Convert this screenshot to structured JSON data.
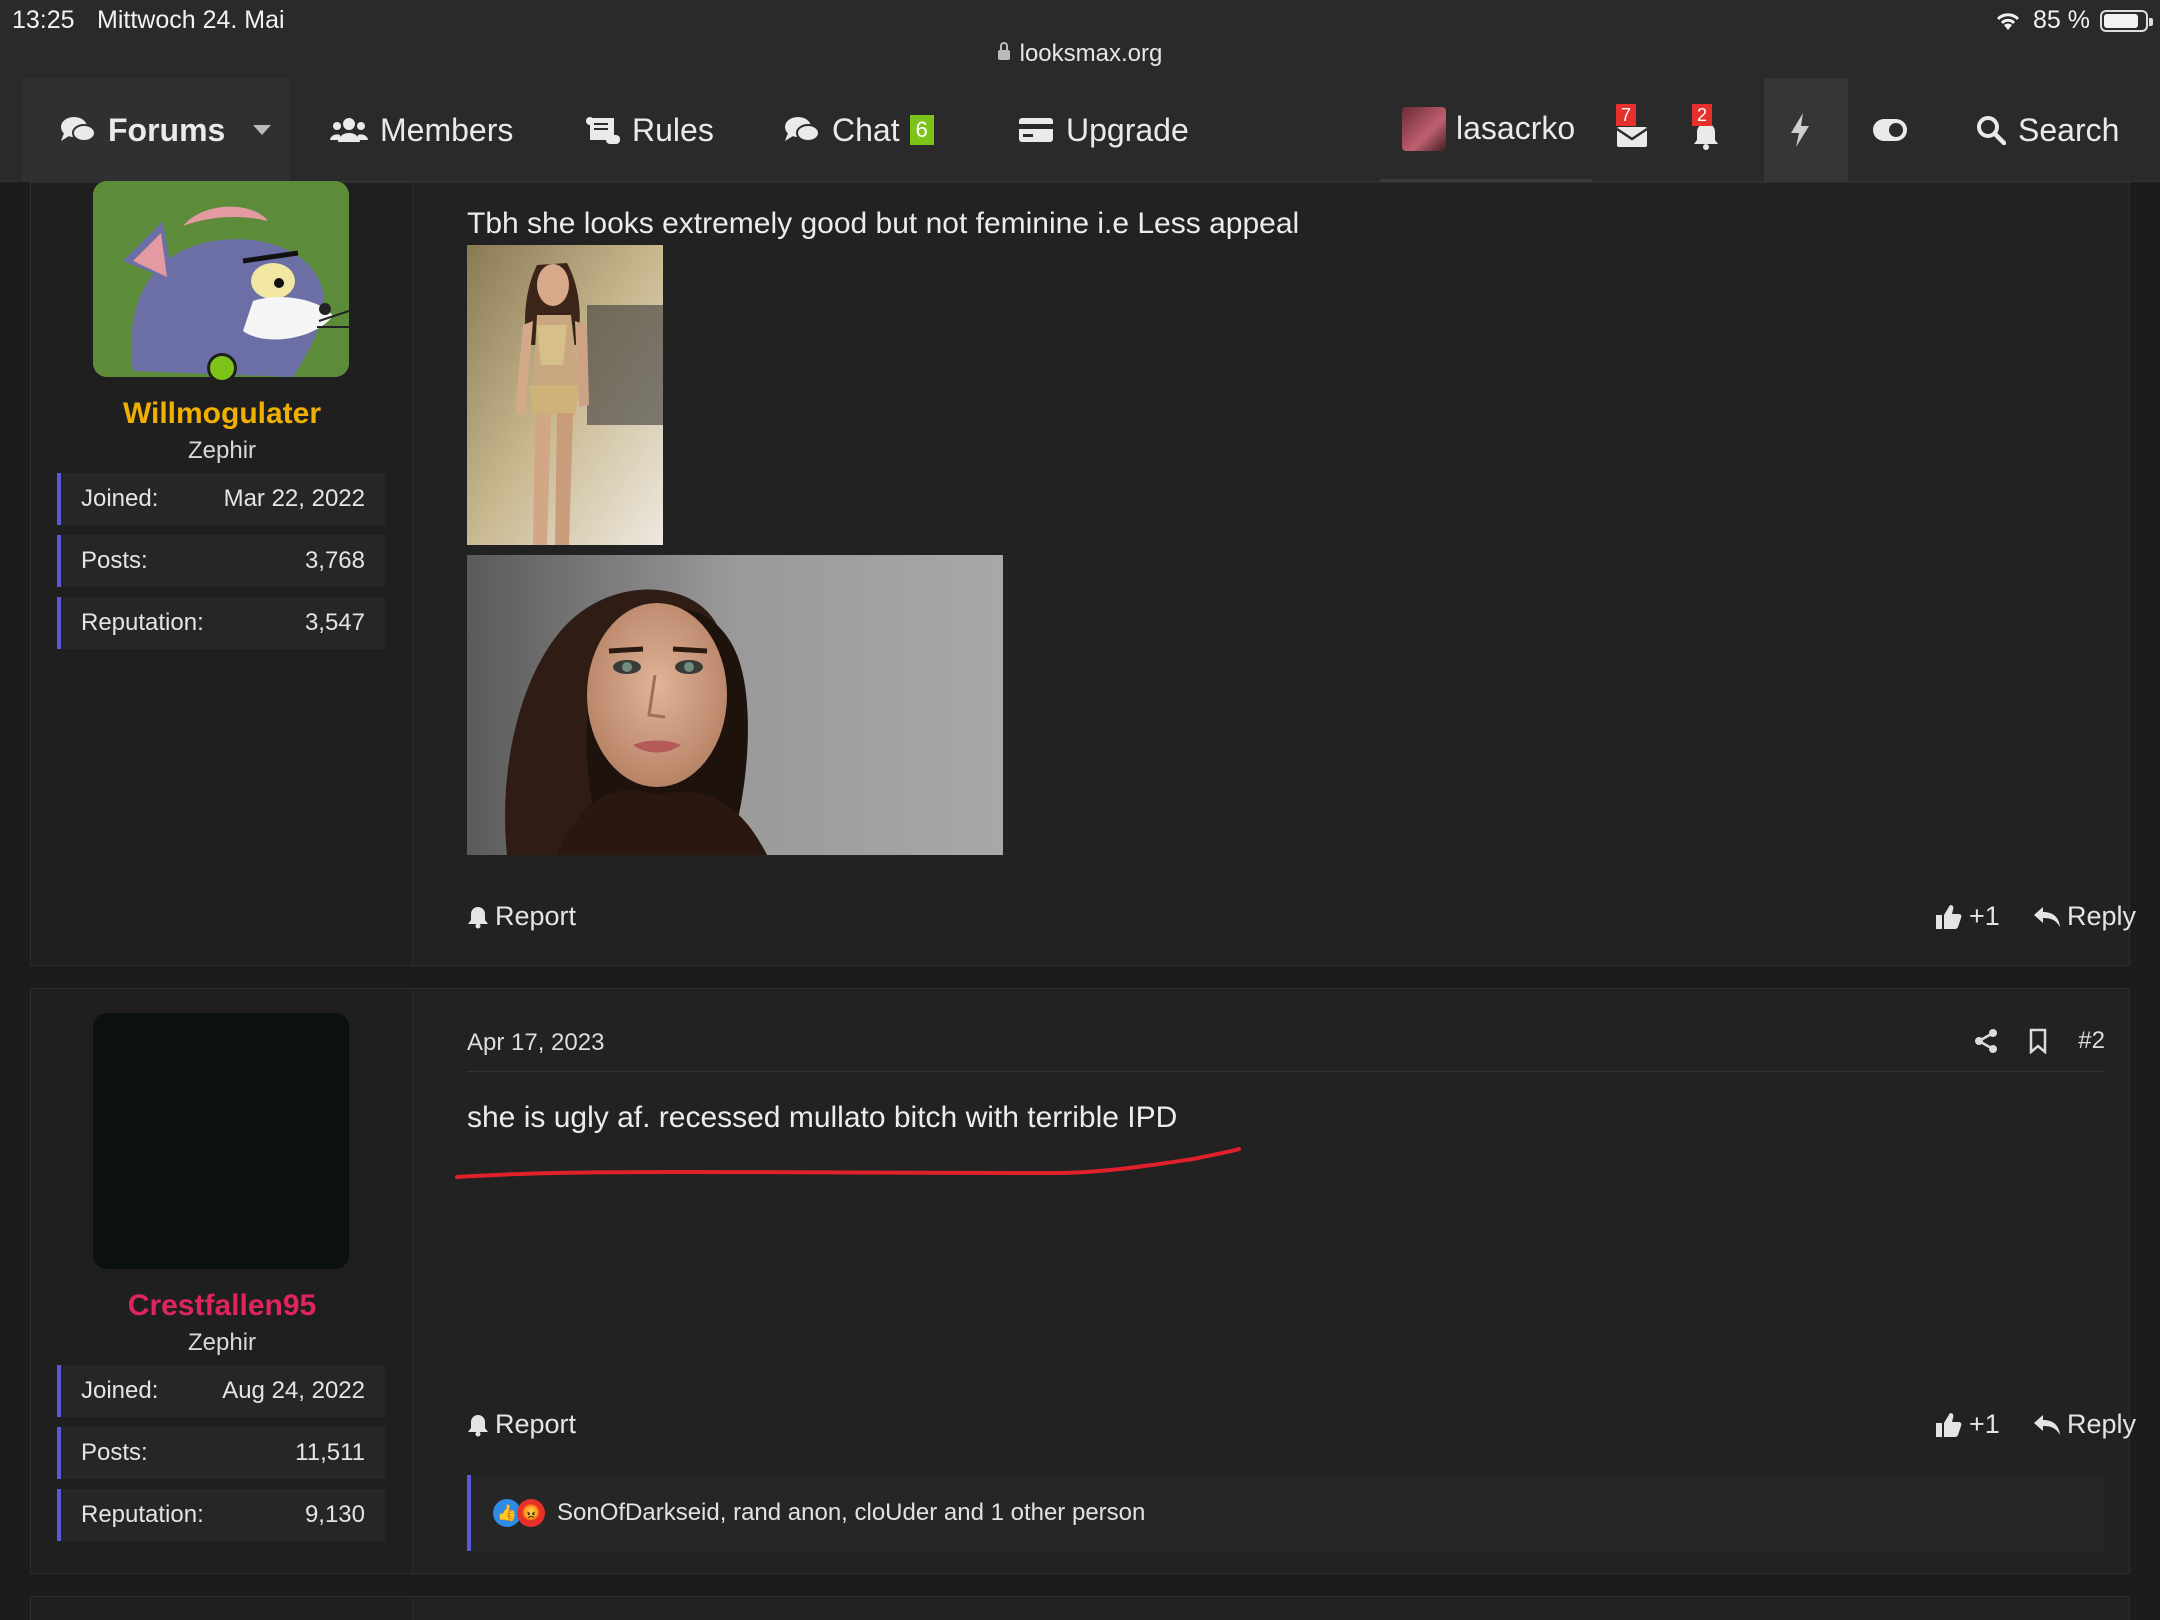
{
  "status": {
    "time": "13:25",
    "date": "Mittwoch 24. Mai",
    "battery": "85 %",
    "battery_level": 0.85
  },
  "browser": {
    "url": "looksmax.org"
  },
  "nav": {
    "forums": "Forums",
    "members": "Members",
    "rules": "Rules",
    "chat": "Chat",
    "chat_badge": "6",
    "upgrade": "Upgrade",
    "username": "lasacrko",
    "inbox_badge": "7",
    "alerts_badge": "2",
    "search": "Search"
  },
  "posts": [
    {
      "username": "Willmogulater",
      "user_title": "Zephir",
      "username_color": "#f0b000",
      "stats": [
        {
          "label": "Joined:",
          "value": "Mar 22, 2022"
        },
        {
          "label": "Posts:",
          "value": "3,768"
        },
        {
          "label": "Reputation:",
          "value": "3,547"
        }
      ],
      "text": "Tbh she looks extremely good but not feminine i.e Less appeal",
      "report": "Report",
      "like": "+1",
      "reply": "Reply"
    },
    {
      "username": "Crestfallen95",
      "user_title": "Zephir",
      "username_color": "#e0245e",
      "date": "Apr 17, 2023",
      "number": "#2",
      "stats": [
        {
          "label": "Joined:",
          "value": "Aug 24, 2022"
        },
        {
          "label": "Posts:",
          "value": "11,511"
        },
        {
          "label": "Reputation:",
          "value": "9,130"
        }
      ],
      "text": "she is ugly af. recessed mullato bitch with terrible IPD",
      "report": "Report",
      "like": "+1",
      "reply": "Reply",
      "reactions": "SonOfDarkseid, rand anon, cloUder and 1 other person"
    }
  ],
  "colors": {
    "accent_border": "#5a5ad8",
    "online": "#7cc41a",
    "badge_red": "#e5302b",
    "annotation": "#e0202a"
  }
}
